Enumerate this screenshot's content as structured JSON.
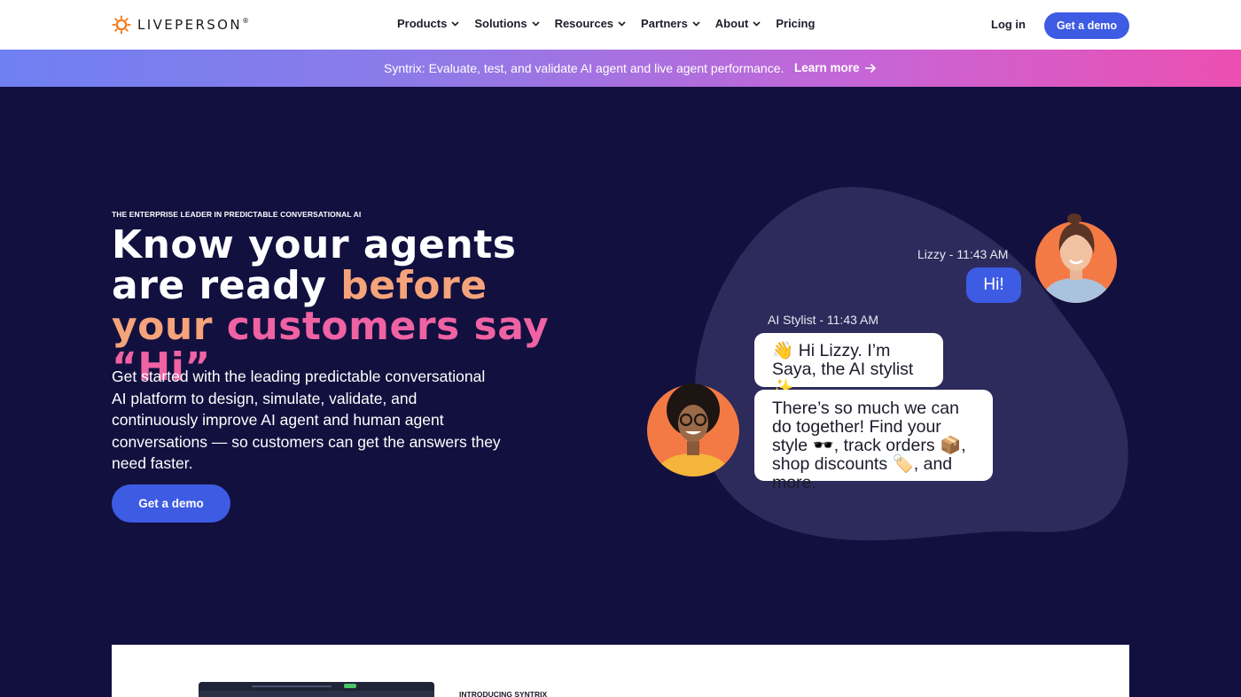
{
  "nav": {
    "logo_text": "LIVEPERSON",
    "logo_mark": "®",
    "menu": [
      {
        "label": "Products",
        "has_dropdown": true
      },
      {
        "label": "Solutions",
        "has_dropdown": true
      },
      {
        "label": "Resources",
        "has_dropdown": true
      },
      {
        "label": "Partners",
        "has_dropdown": true
      },
      {
        "label": "About",
        "has_dropdown": true
      },
      {
        "label": "Pricing",
        "has_dropdown": false
      }
    ],
    "login_label": "Log in",
    "demo_label": "Get a demo"
  },
  "banner": {
    "text": "Syntrix: Evaluate, test, and validate AI agent and live agent performance.",
    "link_label": "Learn more"
  },
  "hero": {
    "eyebrow": "THE ENTERPRISE LEADER IN PREDICTABLE CONVERSATIONAL AI",
    "headline_white": "Know your agents are ready",
    "headline_peach": "before your",
    "headline_pink": "customers say “Hi”",
    "body": "Get started with the leading predictable conversational AI platform to design, simulate, validate, and continuously improve AI agent and human agent conversations — so customers can get the answers they need faster.",
    "cta_label": "Get a demo"
  },
  "chat": {
    "user_timestamp": "Lizzy - 11:43 AM",
    "user_message": "Hi!",
    "bot_timestamp": "AI Stylist - 11:43 AM",
    "bot_message_1": "👋 Hi Lizzy. I’m Saya, the AI stylist ✨",
    "bot_message_2": "There’s so much we can do together! Find your style 🕶️, track orders 📦, shop discounts 🏷️, and more."
  },
  "card": {
    "eyebrow": "INTRODUCING SYNTRIX"
  },
  "colors": {
    "background": "#12103f",
    "accent": "#3d5be3",
    "peach": "#f5a37a",
    "pink": "#ef62a3",
    "banner_start": "#6f80f2",
    "banner_end": "#ec4fb1"
  }
}
